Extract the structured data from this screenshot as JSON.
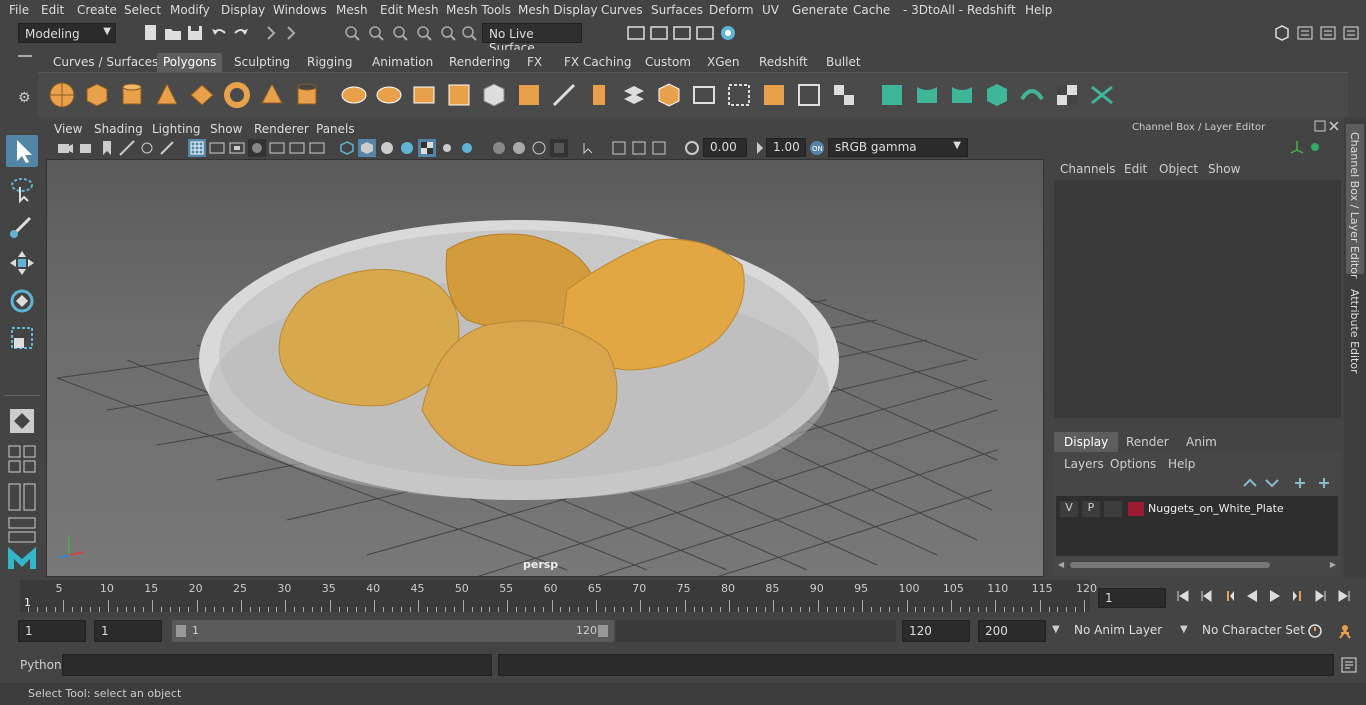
{
  "menu": [
    "File",
    "Edit",
    "Create",
    "Select",
    "Modify",
    "Display",
    "Windows",
    "Mesh",
    "Edit Mesh",
    "Mesh Tools",
    "Mesh Display",
    "Curves",
    "Surfaces",
    "Deform",
    "UV",
    "Generate",
    "Cache",
    "- 3DtoAll -",
    "Redshift",
    "Help"
  ],
  "status": {
    "mode": "Modeling",
    "live_surface": "No Live Surface"
  },
  "shelf_tabs": [
    "Curves / Surfaces",
    "Polygons",
    "Sculpting",
    "Rigging",
    "Animation",
    "Rendering",
    "FX",
    "FX Caching",
    "Custom",
    "XGen",
    "Redshift",
    "Bullet"
  ],
  "active_shelf": "Polygons",
  "panel_menu": [
    "View",
    "Shading",
    "Lighting",
    "Show",
    "Renderer",
    "Panels"
  ],
  "panel_toolbar": {
    "exposure": "0.00",
    "gamma": "1.00",
    "colorspace": "sRGB gamma"
  },
  "viewport": {
    "camera_label": "persp"
  },
  "channel_box": {
    "title": "Channel Box / Layer Editor",
    "menu": [
      "Channels",
      "Edit",
      "Object",
      "Show"
    ]
  },
  "layer_editor": {
    "tabs": [
      "Display",
      "Render",
      "Anim"
    ],
    "active_tab": "Display",
    "menu": [
      "Layers",
      "Options",
      "Help"
    ],
    "layers": [
      {
        "v": "V",
        "p": "P",
        "name": "Nuggets_on_White_Plate",
        "color": "#9b1c31"
      }
    ]
  },
  "side_tabs": [
    "Channel Box / Layer Editor",
    "Attribute Editor"
  ],
  "timeline": {
    "ticks": [
      5,
      10,
      15,
      20,
      25,
      30,
      35,
      40,
      45,
      50,
      55,
      60,
      65,
      70,
      75,
      80,
      85,
      90,
      95,
      100,
      105,
      110,
      115,
      120
    ],
    "current_frame_marker": "1",
    "current_frame_field": "1"
  },
  "range": {
    "start": "1",
    "playback_start": "1",
    "slider_start": "1",
    "slider_end": "120",
    "playback_end": "120",
    "end": "200",
    "anim_layer": "No Anim Layer",
    "character_set": "No Character Set"
  },
  "command_line": {
    "label": "Python"
  },
  "help_line": "Select Tool: select an object",
  "colors": {
    "accent": "#5285a6",
    "shelf_orange": "#e8a04a",
    "shelf_teal": "#3fb59a",
    "layer_red": "#9b1c31"
  }
}
